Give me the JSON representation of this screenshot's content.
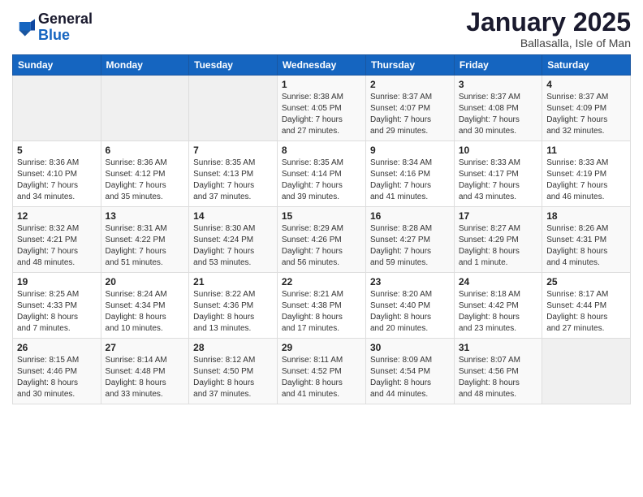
{
  "logo": {
    "general": "General",
    "blue": "Blue"
  },
  "header": {
    "month": "January 2025",
    "location": "Ballasalla, Isle of Man"
  },
  "weekdays": [
    "Sunday",
    "Monday",
    "Tuesday",
    "Wednesday",
    "Thursday",
    "Friday",
    "Saturday"
  ],
  "weeks": [
    [
      {
        "day": "",
        "info": ""
      },
      {
        "day": "",
        "info": ""
      },
      {
        "day": "",
        "info": ""
      },
      {
        "day": "1",
        "info": "Sunrise: 8:38 AM\nSunset: 4:05 PM\nDaylight: 7 hours\nand 27 minutes."
      },
      {
        "day": "2",
        "info": "Sunrise: 8:37 AM\nSunset: 4:07 PM\nDaylight: 7 hours\nand 29 minutes."
      },
      {
        "day": "3",
        "info": "Sunrise: 8:37 AM\nSunset: 4:08 PM\nDaylight: 7 hours\nand 30 minutes."
      },
      {
        "day": "4",
        "info": "Sunrise: 8:37 AM\nSunset: 4:09 PM\nDaylight: 7 hours\nand 32 minutes."
      }
    ],
    [
      {
        "day": "5",
        "info": "Sunrise: 8:36 AM\nSunset: 4:10 PM\nDaylight: 7 hours\nand 34 minutes."
      },
      {
        "day": "6",
        "info": "Sunrise: 8:36 AM\nSunset: 4:12 PM\nDaylight: 7 hours\nand 35 minutes."
      },
      {
        "day": "7",
        "info": "Sunrise: 8:35 AM\nSunset: 4:13 PM\nDaylight: 7 hours\nand 37 minutes."
      },
      {
        "day": "8",
        "info": "Sunrise: 8:35 AM\nSunset: 4:14 PM\nDaylight: 7 hours\nand 39 minutes."
      },
      {
        "day": "9",
        "info": "Sunrise: 8:34 AM\nSunset: 4:16 PM\nDaylight: 7 hours\nand 41 minutes."
      },
      {
        "day": "10",
        "info": "Sunrise: 8:33 AM\nSunset: 4:17 PM\nDaylight: 7 hours\nand 43 minutes."
      },
      {
        "day": "11",
        "info": "Sunrise: 8:33 AM\nSunset: 4:19 PM\nDaylight: 7 hours\nand 46 minutes."
      }
    ],
    [
      {
        "day": "12",
        "info": "Sunrise: 8:32 AM\nSunset: 4:21 PM\nDaylight: 7 hours\nand 48 minutes."
      },
      {
        "day": "13",
        "info": "Sunrise: 8:31 AM\nSunset: 4:22 PM\nDaylight: 7 hours\nand 51 minutes."
      },
      {
        "day": "14",
        "info": "Sunrise: 8:30 AM\nSunset: 4:24 PM\nDaylight: 7 hours\nand 53 minutes."
      },
      {
        "day": "15",
        "info": "Sunrise: 8:29 AM\nSunset: 4:26 PM\nDaylight: 7 hours\nand 56 minutes."
      },
      {
        "day": "16",
        "info": "Sunrise: 8:28 AM\nSunset: 4:27 PM\nDaylight: 7 hours\nand 59 minutes."
      },
      {
        "day": "17",
        "info": "Sunrise: 8:27 AM\nSunset: 4:29 PM\nDaylight: 8 hours\nand 1 minute."
      },
      {
        "day": "18",
        "info": "Sunrise: 8:26 AM\nSunset: 4:31 PM\nDaylight: 8 hours\nand 4 minutes."
      }
    ],
    [
      {
        "day": "19",
        "info": "Sunrise: 8:25 AM\nSunset: 4:33 PM\nDaylight: 8 hours\nand 7 minutes."
      },
      {
        "day": "20",
        "info": "Sunrise: 8:24 AM\nSunset: 4:34 PM\nDaylight: 8 hours\nand 10 minutes."
      },
      {
        "day": "21",
        "info": "Sunrise: 8:22 AM\nSunset: 4:36 PM\nDaylight: 8 hours\nand 13 minutes."
      },
      {
        "day": "22",
        "info": "Sunrise: 8:21 AM\nSunset: 4:38 PM\nDaylight: 8 hours\nand 17 minutes."
      },
      {
        "day": "23",
        "info": "Sunrise: 8:20 AM\nSunset: 4:40 PM\nDaylight: 8 hours\nand 20 minutes."
      },
      {
        "day": "24",
        "info": "Sunrise: 8:18 AM\nSunset: 4:42 PM\nDaylight: 8 hours\nand 23 minutes."
      },
      {
        "day": "25",
        "info": "Sunrise: 8:17 AM\nSunset: 4:44 PM\nDaylight: 8 hours\nand 27 minutes."
      }
    ],
    [
      {
        "day": "26",
        "info": "Sunrise: 8:15 AM\nSunset: 4:46 PM\nDaylight: 8 hours\nand 30 minutes."
      },
      {
        "day": "27",
        "info": "Sunrise: 8:14 AM\nSunset: 4:48 PM\nDaylight: 8 hours\nand 33 minutes."
      },
      {
        "day": "28",
        "info": "Sunrise: 8:12 AM\nSunset: 4:50 PM\nDaylight: 8 hours\nand 37 minutes."
      },
      {
        "day": "29",
        "info": "Sunrise: 8:11 AM\nSunset: 4:52 PM\nDaylight: 8 hours\nand 41 minutes."
      },
      {
        "day": "30",
        "info": "Sunrise: 8:09 AM\nSunset: 4:54 PM\nDaylight: 8 hours\nand 44 minutes."
      },
      {
        "day": "31",
        "info": "Sunrise: 8:07 AM\nSunset: 4:56 PM\nDaylight: 8 hours\nand 48 minutes."
      },
      {
        "day": "",
        "info": ""
      }
    ]
  ]
}
